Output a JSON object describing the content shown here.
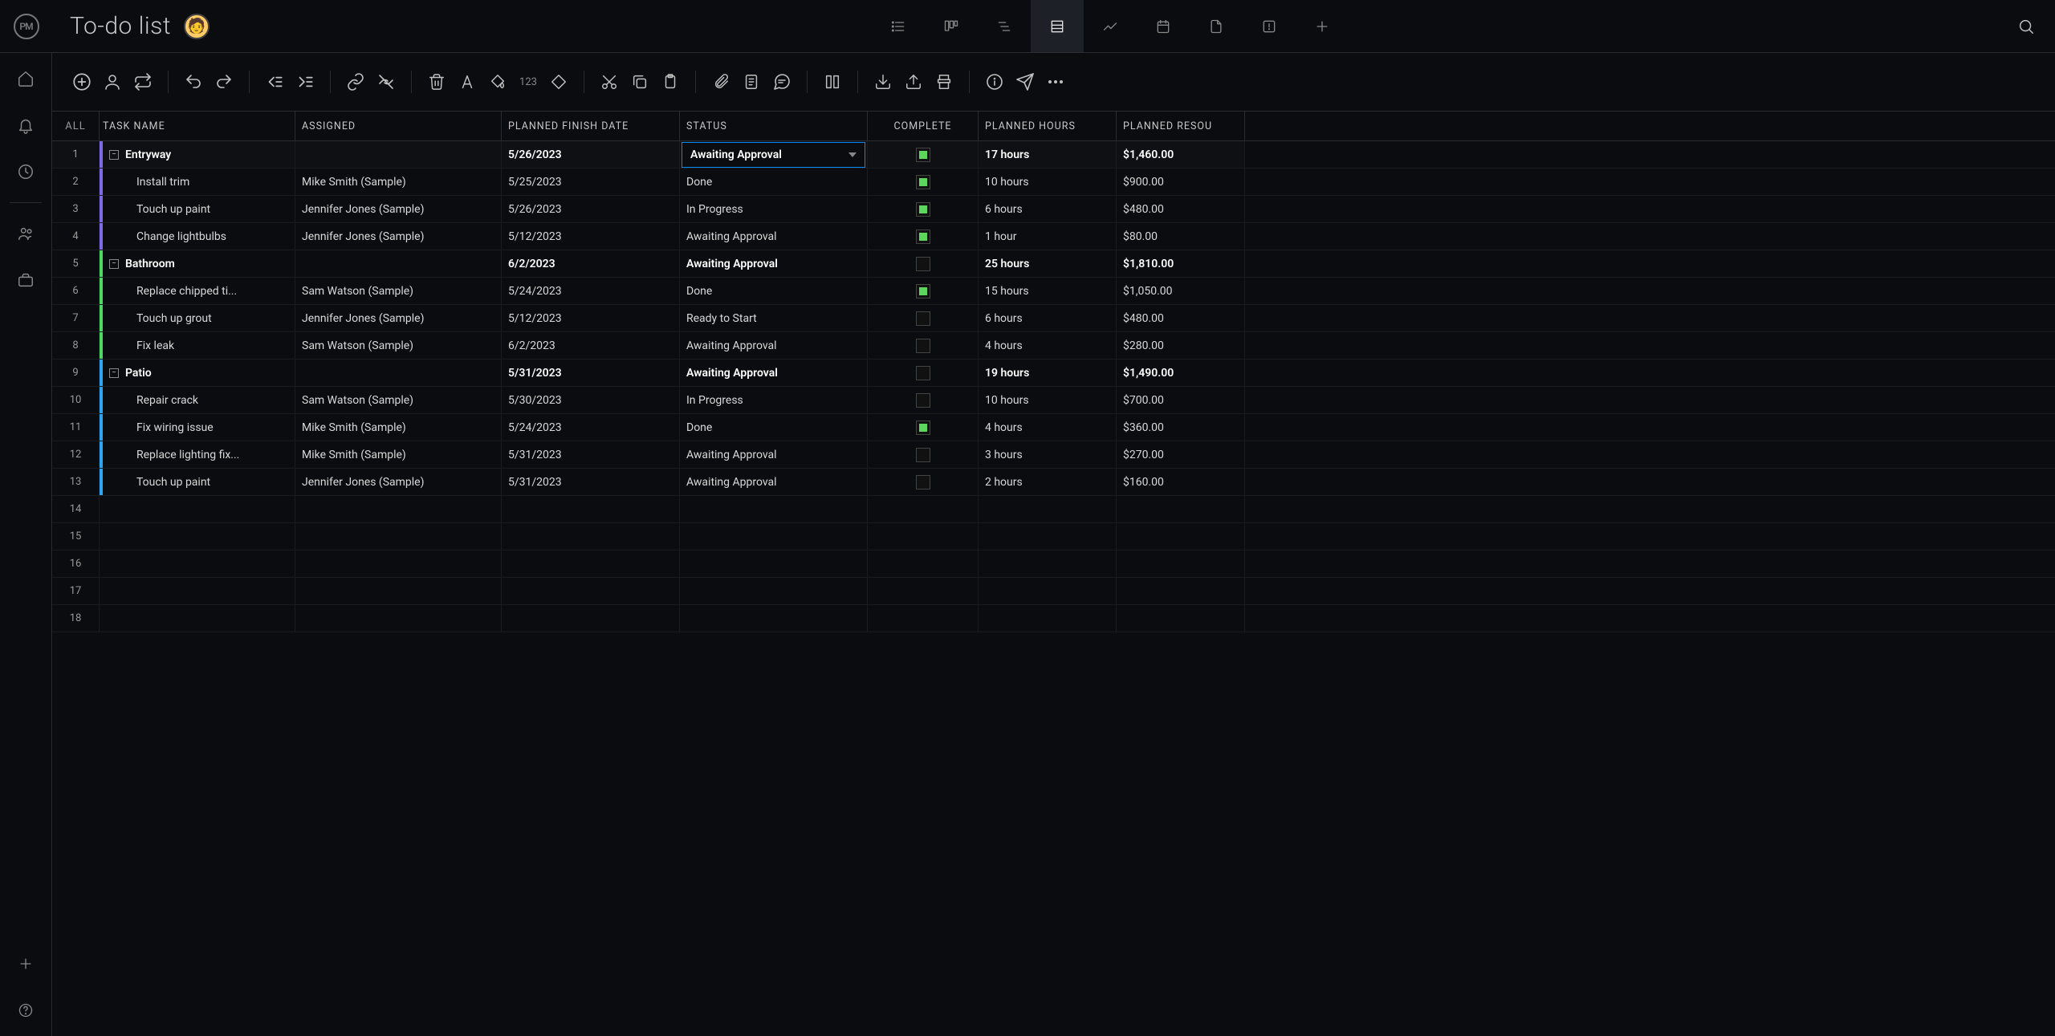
{
  "header": {
    "logo_text": "PM",
    "title": "To-do list"
  },
  "columns": {
    "all": "ALL",
    "task": "TASK NAME",
    "assigned": "ASSIGNED",
    "date": "PLANNED FINISH DATE",
    "status": "STATUS",
    "complete": "COMPLETE",
    "hours": "PLANNED HOURS",
    "cost": "PLANNED RESOU"
  },
  "toolbar": {
    "num_label": "123"
  },
  "rows": [
    {
      "num": "1",
      "color": "#7b6be6",
      "indent": 12,
      "group": true,
      "task": "Entryway",
      "assigned": "",
      "date": "5/26/2023",
      "status": "Awaiting Approval",
      "status_dd": true,
      "complete": true,
      "hours": "17 hours",
      "cost": "$1,460.00",
      "bold": true,
      "selected": true
    },
    {
      "num": "2",
      "color": "#7b6be6",
      "indent": 46,
      "group": false,
      "task": "Install trim",
      "assigned": "Mike Smith (Sample)",
      "date": "5/25/2023",
      "status": "Done",
      "complete": true,
      "hours": "10 hours",
      "cost": "$900.00"
    },
    {
      "num": "3",
      "color": "#7b6be6",
      "indent": 46,
      "group": false,
      "task": "Touch up paint",
      "assigned": "Jennifer Jones (Sample)",
      "date": "5/26/2023",
      "status": "In Progress",
      "complete": true,
      "hours": "6 hours",
      "cost": "$480.00"
    },
    {
      "num": "4",
      "color": "#7b6be6",
      "indent": 46,
      "group": false,
      "task": "Change lightbulbs",
      "assigned": "Jennifer Jones (Sample)",
      "date": "5/12/2023",
      "status": "Awaiting Approval",
      "complete": true,
      "hours": "1 hour",
      "cost": "$80.00"
    },
    {
      "num": "5",
      "color": "#4bd964",
      "indent": 12,
      "group": true,
      "task": "Bathroom",
      "assigned": "",
      "date": "6/2/2023",
      "status": "Awaiting Approval",
      "complete": false,
      "hours": "25 hours",
      "cost": "$1,810.00",
      "bold": true
    },
    {
      "num": "6",
      "color": "#4bd964",
      "indent": 46,
      "group": false,
      "task": "Replace chipped ti...",
      "assigned": "Sam Watson (Sample)",
      "date": "5/24/2023",
      "status": "Done",
      "complete": true,
      "hours": "15 hours",
      "cost": "$1,050.00"
    },
    {
      "num": "7",
      "color": "#4bd964",
      "indent": 46,
      "group": false,
      "task": "Touch up grout",
      "assigned": "Jennifer Jones (Sample)",
      "date": "5/12/2023",
      "status": "Ready to Start",
      "complete": false,
      "hours": "6 hours",
      "cost": "$480.00"
    },
    {
      "num": "8",
      "color": "#4bd964",
      "indent": 46,
      "group": false,
      "task": "Fix leak",
      "assigned": "Sam Watson (Sample)",
      "date": "6/2/2023",
      "status": "Awaiting Approval",
      "complete": false,
      "hours": "4 hours",
      "cost": "$280.00"
    },
    {
      "num": "9",
      "color": "#2ea3f2",
      "indent": 12,
      "group": true,
      "task": "Patio",
      "assigned": "",
      "date": "5/31/2023",
      "status": "Awaiting Approval",
      "complete": false,
      "hours": "19 hours",
      "cost": "$1,490.00",
      "bold": true
    },
    {
      "num": "10",
      "color": "#2ea3f2",
      "indent": 46,
      "group": false,
      "task": "Repair crack",
      "assigned": "Sam Watson (Sample)",
      "date": "5/30/2023",
      "status": "In Progress",
      "complete": false,
      "hours": "10 hours",
      "cost": "$700.00"
    },
    {
      "num": "11",
      "color": "#2ea3f2",
      "indent": 46,
      "group": false,
      "task": "Fix wiring issue",
      "assigned": "Mike Smith (Sample)",
      "date": "5/24/2023",
      "status": "Done",
      "complete": true,
      "hours": "4 hours",
      "cost": "$360.00"
    },
    {
      "num": "12",
      "color": "#2ea3f2",
      "indent": 46,
      "group": false,
      "task": "Replace lighting fix...",
      "assigned": "Mike Smith (Sample)",
      "date": "5/31/2023",
      "status": "Awaiting Approval",
      "complete": false,
      "hours": "3 hours",
      "cost": "$270.00"
    },
    {
      "num": "13",
      "color": "#2ea3f2",
      "indent": 46,
      "group": false,
      "task": "Touch up paint",
      "assigned": "Jennifer Jones (Sample)",
      "date": "5/31/2023",
      "status": "Awaiting Approval",
      "complete": false,
      "hours": "2 hours",
      "cost": "$160.00"
    }
  ],
  "empty_rows": [
    "14",
    "15",
    "16",
    "17",
    "18"
  ]
}
